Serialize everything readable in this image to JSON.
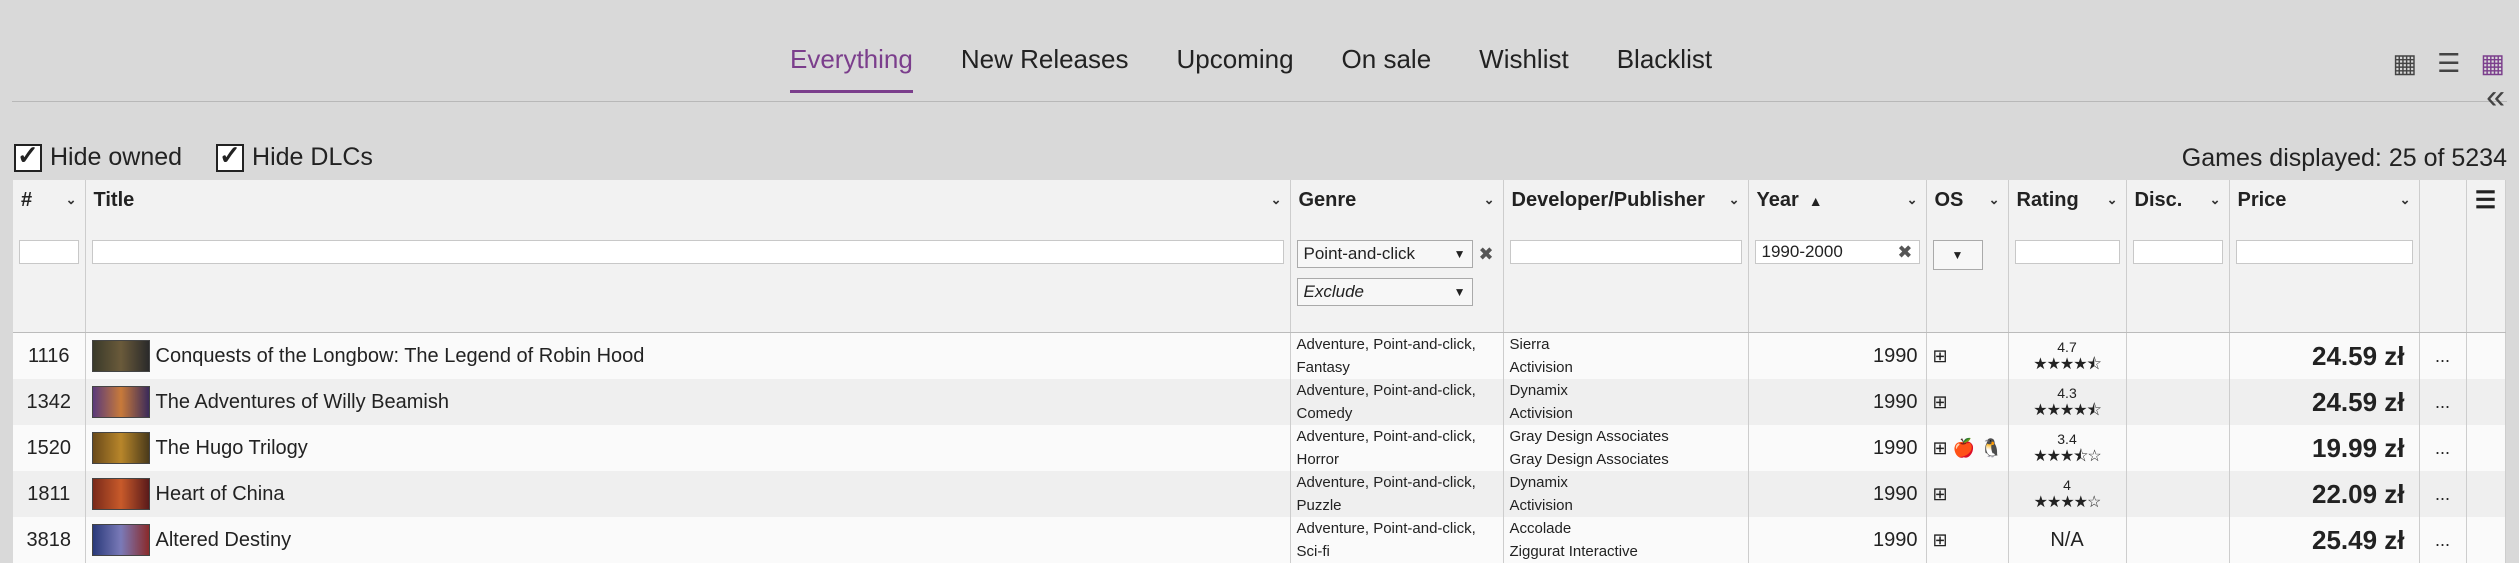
{
  "nav": {
    "tabs": [
      "Everything",
      "New Releases",
      "Upcoming",
      "On sale",
      "Wishlist",
      "Blacklist"
    ],
    "active_tab": "Everything",
    "view_icons": [
      "grid-view-icon",
      "list-view-icon",
      "table-view-icon"
    ],
    "active_view": "table-view-icon",
    "collapse_glyph": "«"
  },
  "options": {
    "hide_owned": {
      "label": "Hide owned",
      "checked": true
    },
    "hide_dlcs": {
      "label": "Hide DLCs",
      "checked": true
    },
    "games_displayed": "Games displayed: 25 of 5234"
  },
  "table": {
    "columns": [
      "#",
      "Title",
      "Genre",
      "Developer/Publisher",
      "Year",
      "OS",
      "Rating",
      "Disc.",
      "Price"
    ],
    "sorted_column": "Year",
    "filters": {
      "genre": "Point-and-click",
      "genre_mode": "Exclude",
      "year": "1990-2000"
    },
    "rows": [
      {
        "num": "1116",
        "title": "Conquests of the Longbow: The Legend of Robin Hood",
        "genre1": "Adventure, Point-and-click,",
        "genre2": "Fantasy",
        "dev": "Sierra",
        "pub": "Activision",
        "year": "1990",
        "os": "⊞",
        "rating": "4.7",
        "stars": "★★★★⯪",
        "price": "24.59 zł",
        "more": "..."
      },
      {
        "num": "1342",
        "title": "The Adventures of Willy Beamish",
        "genre1": "Adventure, Point-and-click,",
        "genre2": "Comedy",
        "dev": "Dynamix",
        "pub": "Activision",
        "year": "1990",
        "os": "⊞",
        "rating": "4.3",
        "stars": "★★★★⯪",
        "price": "24.59 zł",
        "more": "..."
      },
      {
        "num": "1520",
        "title": "The Hugo Trilogy",
        "genre1": "Adventure, Point-and-click,",
        "genre2": "Horror",
        "dev": "Gray Design Associates",
        "pub": "Gray Design Associates",
        "year": "1990",
        "os": "⊞  🍎 🐧",
        "rating": "3.4",
        "stars": "★★★⯪☆",
        "price": "19.99 zł",
        "more": "..."
      },
      {
        "num": "1811",
        "title": "Heart of China",
        "genre1": "Adventure, Point-and-click,",
        "genre2": "Puzzle",
        "dev": "Dynamix",
        "pub": "Activision",
        "year": "1990",
        "os": "⊞",
        "rating": "4",
        "stars": "★★★★☆",
        "price": "22.09 zł",
        "more": "..."
      },
      {
        "num": "3818",
        "title": "Altered Destiny",
        "genre1": "Adventure, Point-and-click,",
        "genre2": "Sci-fi",
        "dev": "Accolade",
        "pub": "Ziggurat Interactive",
        "year": "1990",
        "os": "⊞",
        "rating": "N/A",
        "stars": "",
        "price": "25.49 zł",
        "more": "..."
      }
    ]
  },
  "colors": {
    "accent": "#7b3e8c",
    "background": "#d9d9d9"
  }
}
